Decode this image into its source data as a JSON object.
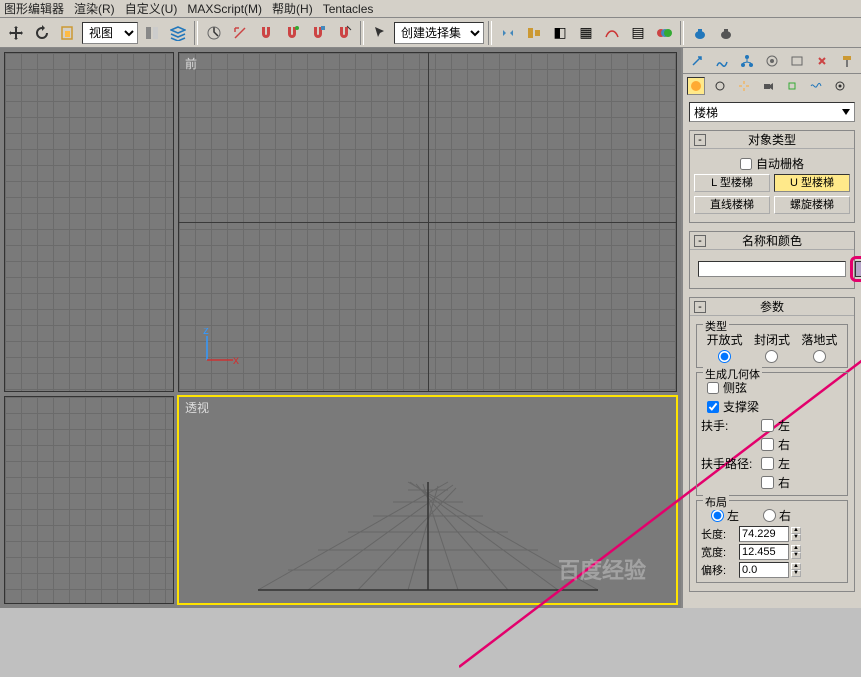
{
  "menu": {
    "items": [
      "图形编辑器",
      "渲染(R)",
      "自定义(U)",
      "MAXScript(M)",
      "帮助(H)",
      "Tentacles"
    ]
  },
  "toolbar": {
    "view_dropdown": "视图",
    "select_set_placeholder": "创建选择集"
  },
  "viewports": {
    "top_left": "",
    "top_right": "前",
    "bottom_left": "",
    "bottom_right": "透视",
    "axis_x": "x",
    "axis_z": "z"
  },
  "panel": {
    "category": "楼梯",
    "rollouts": {
      "object_type": {
        "title": "对象类型",
        "auto_grid": "自动栅格",
        "l_stairs": "L 型楼梯",
        "u_stairs": "U 型楼梯",
        "straight": "直线楼梯",
        "spiral": "螺旋楼梯"
      },
      "name_color": {
        "title": "名称和颜色",
        "value": ""
      },
      "params": {
        "title": "参数",
        "type_group": "类型",
        "open": "开放式",
        "closed": "封闭式",
        "floor": "落地式",
        "gen_geom": "生成几何体",
        "stringers": "侧弦",
        "carriage": "支撑梁",
        "handrail": "扶手:",
        "rail_path": "扶手路径:",
        "left": "左",
        "right": "右",
        "layout": "布局",
        "layout_left": "左",
        "layout_right": "右",
        "length": "长度:",
        "width": "宽度:",
        "offset": "偏移:",
        "length_val": "74.229",
        "width_val": "12.455",
        "offset_val": "0.0"
      }
    }
  }
}
